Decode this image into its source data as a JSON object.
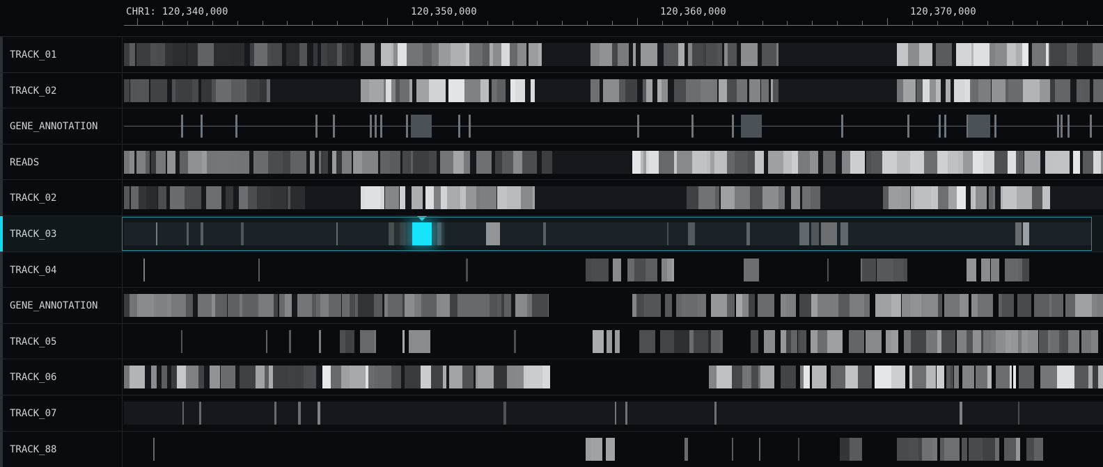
{
  "ruler": {
    "chromosome": "CHR1",
    "labels": [
      "CHR1: 120,340,000",
      "120,350,000",
      "120,360,000",
      "120,370,000"
    ]
  },
  "colors": {
    "background": "#090b0e",
    "accent": "#19d6ec",
    "track_base": "#15191d",
    "label_text": "#cfd4d9"
  },
  "tracks": [
    {
      "label": "TRACK_01"
    },
    {
      "label": "TRACK_02"
    },
    {
      "label": "GENE_ANNOTATION"
    },
    {
      "label": "READS"
    },
    {
      "label": "TRACK_02"
    },
    {
      "label": "TRACK_03",
      "selected": true
    },
    {
      "label": "TRACK_04"
    },
    {
      "label": "GENE_ANNOTATION"
    },
    {
      "label": "TRACK_05"
    },
    {
      "label": "TRACK_06"
    },
    {
      "label": "TRACK_07"
    },
    {
      "label": "TRACK_88"
    }
  ]
}
